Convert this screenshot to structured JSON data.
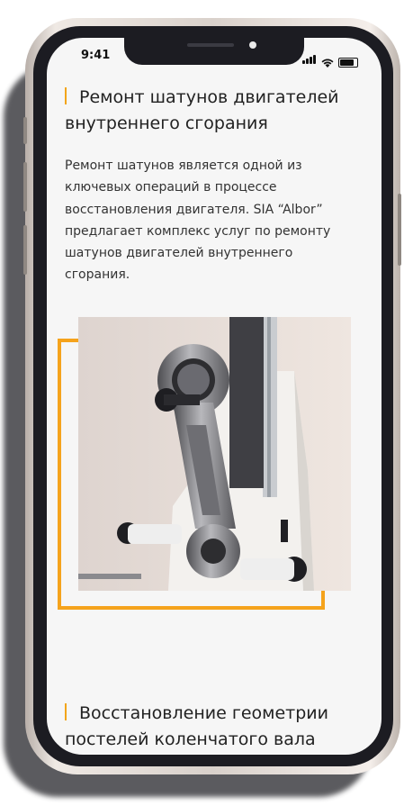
{
  "status_bar": {
    "time": "9:41"
  },
  "section1": {
    "title": "Ремонт шатунов двигателей внутреннего сгорания",
    "text": "Ремонт шатунов является одной из ключевых операций в процессе восстановления двигателя. SIA “Albor” предлагает комплекс услуг по ремонту шатунов двигателей внутреннего сгорания."
  },
  "section2": {
    "title": "Восстановление геометрии постелей коленчатого вала"
  },
  "colors": {
    "accent": "#f5a31c",
    "screen_bg": "#f6f6f6",
    "text": "#333333"
  }
}
